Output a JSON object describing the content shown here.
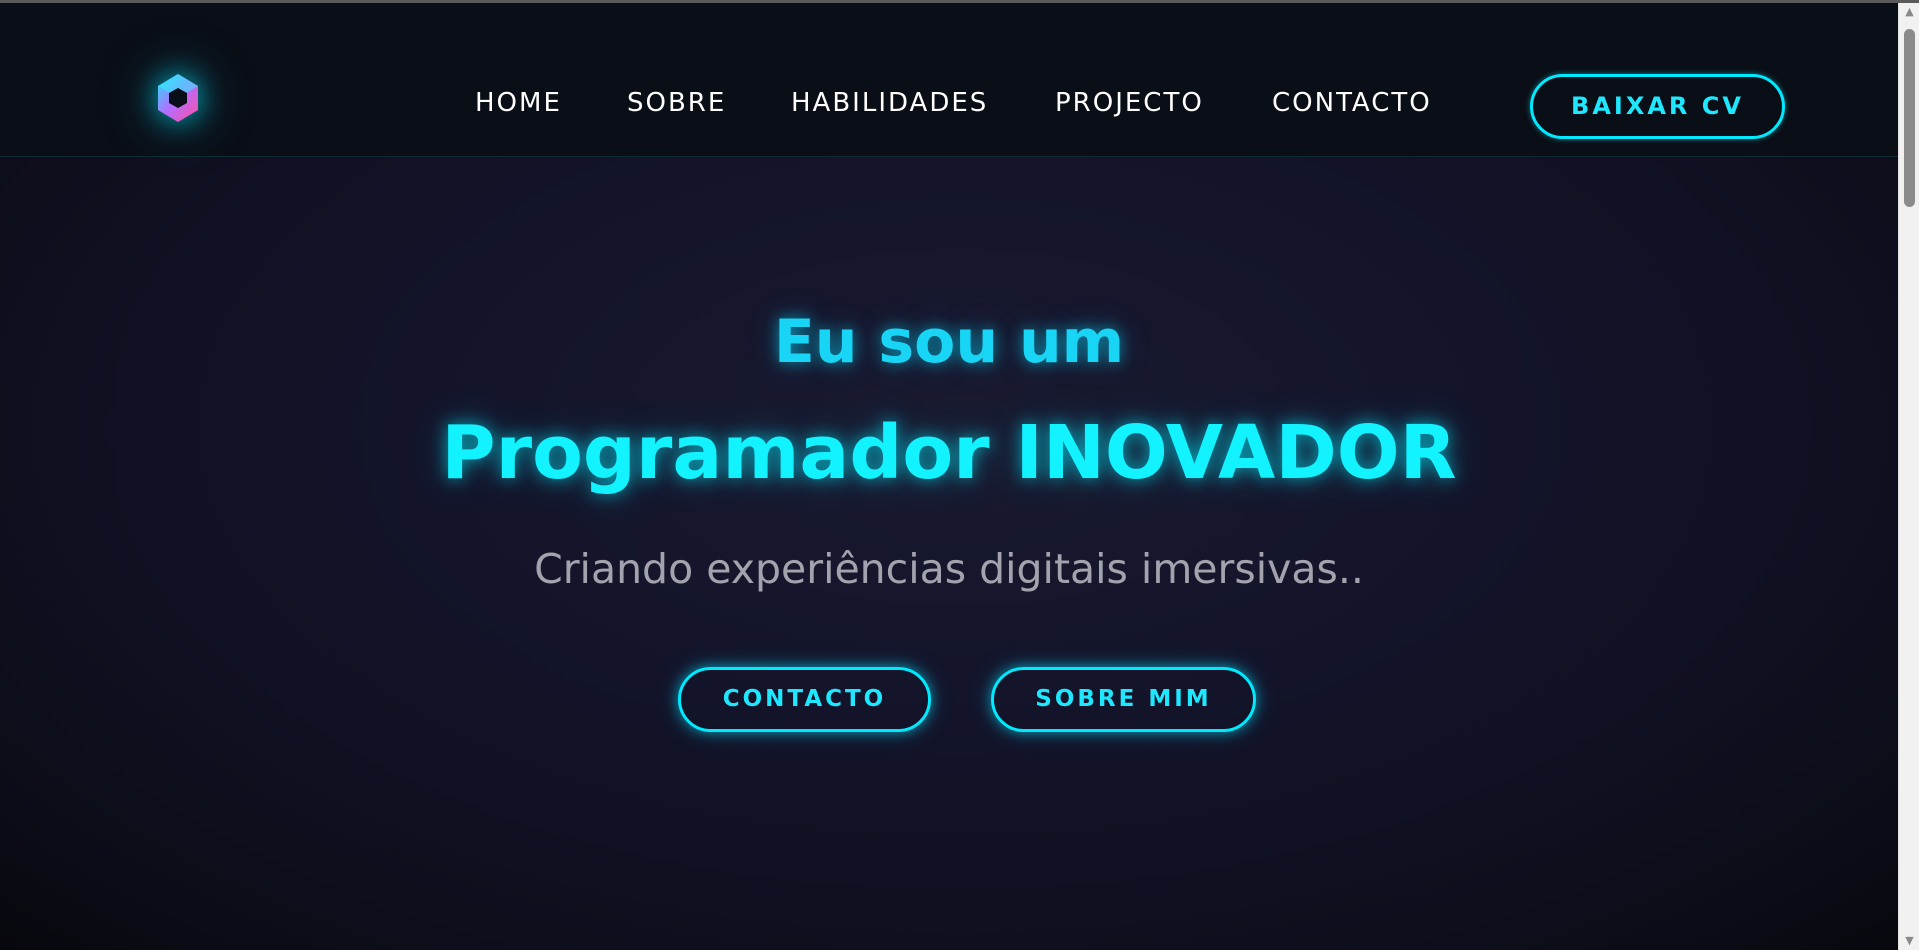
{
  "header": {
    "logo_icon": "hexagon-logo-icon",
    "nav": [
      {
        "label": "HOME"
      },
      {
        "label": "SOBRE"
      },
      {
        "label": "HABILIDADES"
      },
      {
        "label": "PROJECTO"
      },
      {
        "label": "CONTACTO"
      }
    ],
    "cta_label": "BAIXAR CV"
  },
  "hero": {
    "line1": "Eu sou um",
    "line2": "Programador INOVADOR",
    "subtitle": "Criando experiências digitais imersivas..",
    "buttons": {
      "contact": "CONTACTO",
      "about": "SOBRE MIM"
    }
  },
  "colors": {
    "accent": "#00eaff",
    "background": "#13142a",
    "navbar": "#0a0e16",
    "subtitle": "#a3a3ad",
    "logo_gradient": [
      "#1ee8ff",
      "#c86bff",
      "#ff4fa3"
    ]
  },
  "scrollbar": {
    "up_icon": "arrow-up-icon",
    "down_icon": "arrow-down-icon"
  }
}
